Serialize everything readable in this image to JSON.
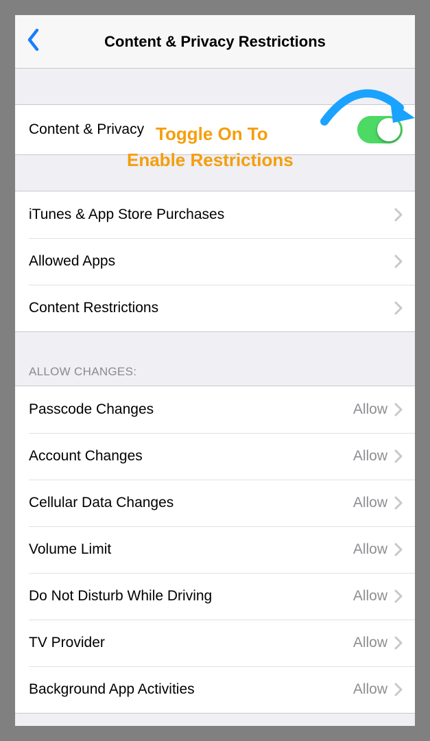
{
  "header": {
    "title": "Content & Privacy Restrictions"
  },
  "toggle_row": {
    "label": "Content & Privacy",
    "state": "on"
  },
  "annotation": {
    "line1": "Toggle On To",
    "line2": "Enable Restrictions"
  },
  "section1": {
    "items": [
      {
        "label": "iTunes & App Store Purchases"
      },
      {
        "label": "Allowed Apps"
      },
      {
        "label": "Content Restrictions"
      }
    ]
  },
  "section2": {
    "header": "ALLOW CHANGES:",
    "items": [
      {
        "label": "Passcode Changes",
        "detail": "Allow"
      },
      {
        "label": "Account Changes",
        "detail": "Allow"
      },
      {
        "label": "Cellular Data Changes",
        "detail": "Allow"
      },
      {
        "label": "Volume Limit",
        "detail": "Allow"
      },
      {
        "label": "Do Not Disturb While Driving",
        "detail": "Allow"
      },
      {
        "label": "TV Provider",
        "detail": "Allow"
      },
      {
        "label": "Background App Activities",
        "detail": "Allow"
      }
    ]
  }
}
